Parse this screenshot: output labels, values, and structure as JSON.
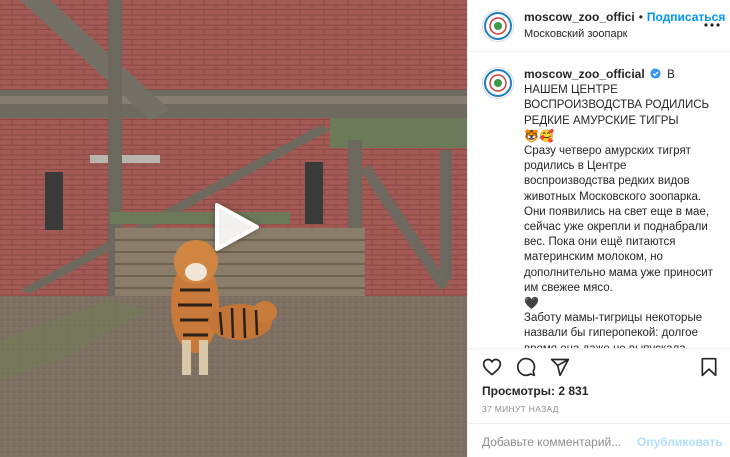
{
  "post": {
    "media": {
      "type": "video",
      "play_icon": "play-icon"
    },
    "header": {
      "username": "moscow_zoo_offici",
      "separator": "•",
      "follow_label": "Подписаться",
      "location": "Московский зоопарк",
      "more_icon": "ellipsis-icon"
    },
    "caption": {
      "username": "moscow_zoo_official",
      "verified_icon": "verified-badge-icon",
      "headline": "В НАШЕМ ЦЕНТРЕ ВОСПРОИЗВОДСТВА РОДИЛИСЬ РЕДКИЕ АМУРСКИЕ ТИГРЫ",
      "emojis": "🐯🥰",
      "paragraph1": "Сразу четверо амурских тигрят родились в Центре воспроизводства редких видов животных Московского зоопарка. Они появились на свет еще в мае, сейчас уже окрепли и поднабрали вес. Пока они ещё питаются материнским молоком, но дополнительно мама уже приносит им свежее мясо.",
      "heart": "🖤",
      "paragraph2": "Заботу мамы-тигрицы некоторые назвали бы гиперопекой: долгое время она даже не выпускала малышей из домика. Но все тигр"
    },
    "actions": {
      "like_icon": "heart-icon",
      "comment_icon": "comment-icon",
      "share_icon": "share-icon",
      "save_icon": "bookmark-icon"
    },
    "views_label": "Просмотры: 2 831",
    "time_ago": "37 МИНУТ НАЗАД",
    "comment_box": {
      "placeholder": "Добавьте комментарий...",
      "post_label": "Опубликовать"
    },
    "colors": {
      "accent": "#0095f6",
      "post_disabled": "#b2dffc",
      "verified": "#3897f0"
    }
  }
}
